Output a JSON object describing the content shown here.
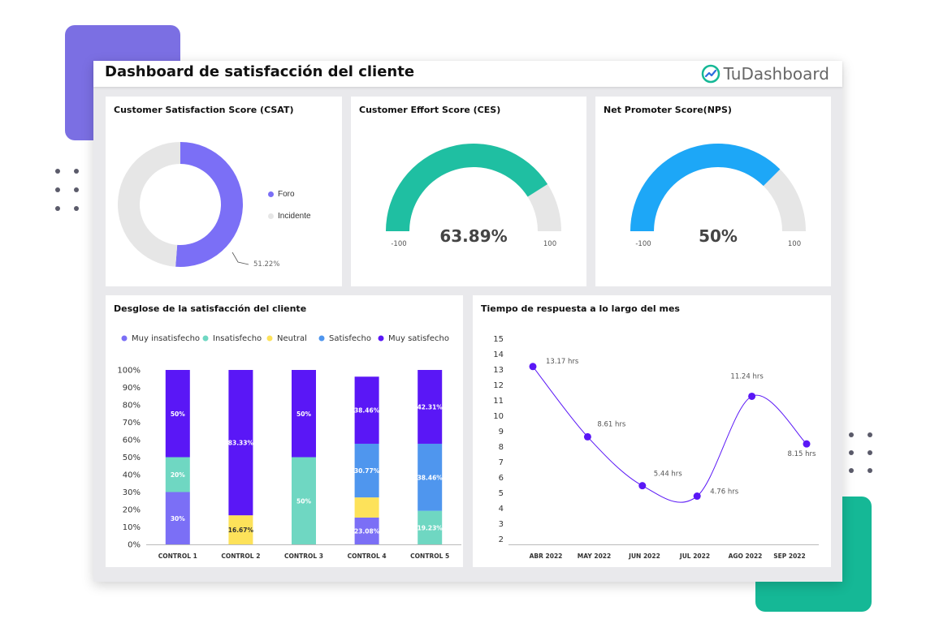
{
  "header": {
    "title": "Dashboard de satisfacción del cliente",
    "brand": "TuDashboard"
  },
  "colors": {
    "accent_purple": "#7b6fe3",
    "accent_green": "#15b896",
    "csat_primary": "#7b6ff6",
    "gauge_track": "#e6e6e6",
    "ces": "#1fbfa2",
    "nps": "#1da7f7",
    "muy_insatisfecho": "#7b6ff6",
    "insatisfecho": "#6fd7c2",
    "neutral": "#fde25a",
    "satisfecho": "#4f96ee",
    "muy_satisfecho": "#5a17f6",
    "line": "#5a17f6"
  },
  "csat": {
    "title": "Customer Satisfaction Score (CSAT)",
    "legend": [
      "Foro",
      "Incidente"
    ],
    "data_label": "51.22%",
    "chart_data": {
      "type": "pie",
      "donut": true,
      "labels": [
        "Foro",
        "Incidente"
      ],
      "values": [
        51.22,
        48.78
      ]
    }
  },
  "ces": {
    "title": "Customer Effort Score (CES)",
    "value_label": "63.89%",
    "min_label": "-100",
    "max_label": "100",
    "chart_data": {
      "type": "gauge",
      "value": 63.89,
      "min": -100,
      "max": 100
    }
  },
  "nps": {
    "title": "Net Promoter Score(NPS)",
    "value_label": "50%",
    "min_label": "-100",
    "max_label": "100",
    "chart_data": {
      "type": "gauge",
      "value": 50,
      "min": -100,
      "max": 100
    }
  },
  "breakdown": {
    "title": "Desglose de la satisfacción del cliente",
    "chart_data": {
      "type": "bar",
      "stacked": true,
      "categories": [
        "CONTROL 1",
        "CONTROL 2",
        "CONTROL 3",
        "CONTROL 4",
        "CONTROL 5"
      ],
      "y_ticks": [
        "0%",
        "10%",
        "20%",
        "30%",
        "40%",
        "50%",
        "60%",
        "70%",
        "80%",
        "90%",
        "100%"
      ],
      "ylim": [
        0,
        100
      ],
      "legend_position": "top",
      "series": [
        {
          "name": "Muy insatisfecho",
          "values": [
            30,
            0,
            0,
            15.38,
            0
          ],
          "labels": [
            "30%",
            "",
            "",
            "",
            ""
          ]
        },
        {
          "name": "Insatisfecho",
          "values": [
            20,
            0,
            50,
            0,
            19.23
          ],
          "labels": [
            "20%",
            "",
            "50%",
            "",
            "19.23%"
          ]
        },
        {
          "name": "Neutral",
          "values": [
            0,
            16.67,
            0,
            11.54,
            0
          ],
          "labels": [
            "",
            "16.67%",
            "",
            "",
            ""
          ]
        },
        {
          "name": "Satisfecho",
          "values": [
            0,
            0,
            0,
            30.77,
            38.46
          ],
          "labels": [
            "",
            "",
            "",
            "30.77%",
            "38.46%"
          ]
        },
        {
          "name": "Muy satisfecho",
          "values": [
            50,
            83.33,
            50,
            38.46,
            42.31
          ],
          "labels": [
            "50%",
            "83.33%",
            "50%",
            "38.46%",
            "42.31%"
          ]
        }
      ],
      "extra_labels": [
        {
          "category": "CONTROL 4",
          "series": "Muy insatisfecho",
          "label": "23.08%"
        }
      ]
    }
  },
  "response": {
    "title": "Tiempo de respuesta a lo largo del mes",
    "chart_data": {
      "type": "line",
      "x": [
        "ABR 2022",
        "MAY 2022",
        "JUN 2022",
        "JUL 2022",
        "AGO 2022",
        "SEP 2022"
      ],
      "ylim": [
        2,
        15
      ],
      "y_ticks": [
        "2",
        "3",
        "4",
        "5",
        "6",
        "7",
        "8",
        "9",
        "10",
        "11",
        "12",
        "13",
        "14",
        "15"
      ],
      "points": [
        {
          "x": "ABR 2022",
          "y": 13.17,
          "label": "13.17 hrs"
        },
        {
          "x": "MAY 2022",
          "y": 8.61,
          "label": "8.61 hrs"
        },
        {
          "x": "JUN 2022",
          "y": 5.44,
          "label": "5.44 hrs"
        },
        {
          "x": "JUL 2022",
          "y": 4.76,
          "label": "4.76 hrs"
        },
        {
          "x": "AGO 2022",
          "y": 11.24,
          "label": "11.24 hrs"
        },
        {
          "x": "SEP 2022",
          "y": 8.15,
          "label": "8.15 hrs"
        }
      ]
    }
  }
}
